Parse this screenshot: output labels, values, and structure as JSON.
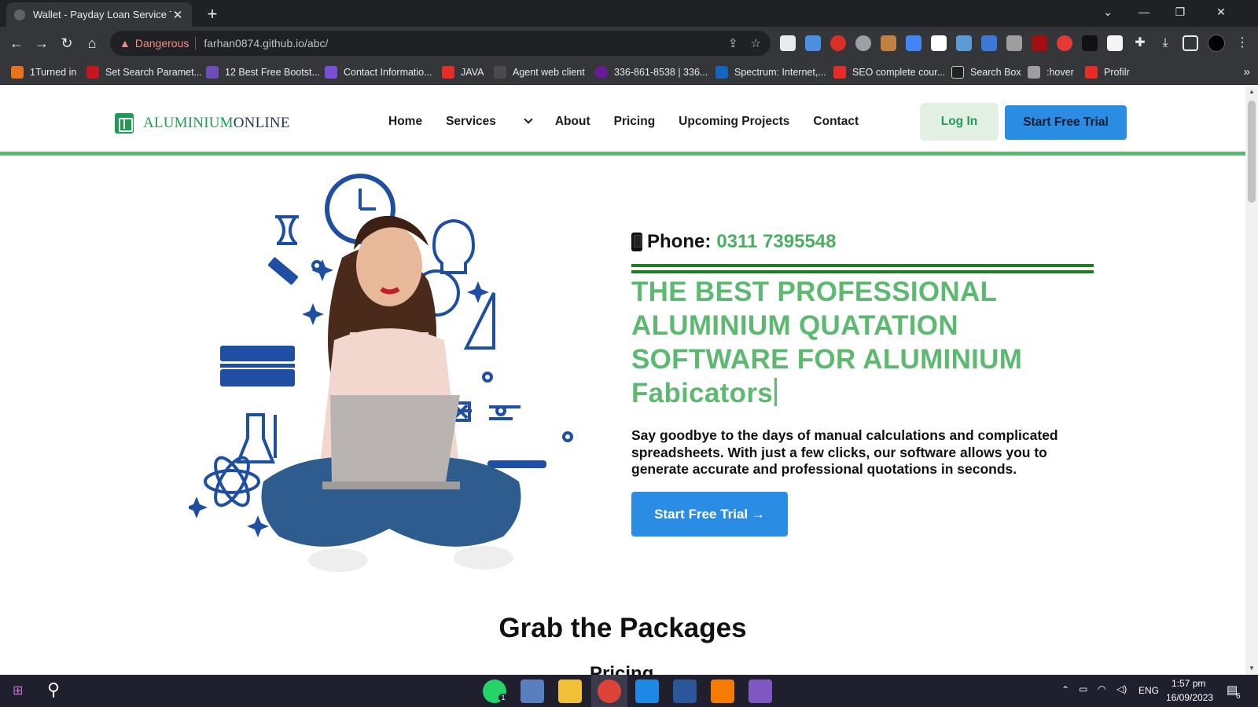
{
  "browser": {
    "tab_title": "Wallet - Payday Loan Service Tem",
    "security_label": "Dangerous",
    "url": "farhan0874.github.io/abc/",
    "bookmarks": [
      {
        "label": "1Turned in",
        "color": "#e8731c"
      },
      {
        "label": "Set Search Paramet...",
        "color": "#c4161c"
      },
      {
        "label": "12 Best Free Bootst...",
        "color": "#6a4fb8"
      },
      {
        "label": "Contact Informatio...",
        "color": "#7a4fd6"
      },
      {
        "label": "JAVA",
        "color": "#e52d27"
      },
      {
        "label": "Agent web client",
        "color": "#4a4a4a"
      },
      {
        "label": "336-861-8538 | 336...",
        "color": "#6a1b9a"
      },
      {
        "label": "Spectrum: Internet,...",
        "color": "#1565c0"
      },
      {
        "label": "SEO complete cour...",
        "color": "#e52d27"
      },
      {
        "label": "Search Box",
        "color": "#222222"
      },
      {
        "label": ":hover",
        "color": "#9e9e9e"
      },
      {
        "label": "Profilr",
        "color": "#e52d27"
      }
    ]
  },
  "site": {
    "logo_part1": "ALUMINIUM",
    "logo_part2": "ONLINE",
    "nav": {
      "home": "Home",
      "services": "Services",
      "about": "About",
      "pricing": "Pricing",
      "projects": "Upcoming Projects",
      "contact": "Contact"
    },
    "login": "Log In",
    "trial": "Start Free Trial"
  },
  "hero": {
    "phone_label": "Phone:",
    "phone_number": "0311 7395548",
    "headline": "THE BEST PROFESSIONAL ALUMINIUM QUATATION SOFTWARE FOR ALUMINIUM Fabicators",
    "lead": "Say goodbye to the days of manual calculations and complicated spreadsheets. With just a few clicks, our software allows you to generate accurate and professional quotations in seconds.",
    "cta": "Start Free Trial →"
  },
  "packages": {
    "title": "Grab the Packages",
    "peek": "Pricing"
  },
  "taskbar": {
    "lang": "ENG",
    "time": "1:57 pm",
    "date": "16/09/2023",
    "notif_count": "6",
    "whatsapp_badge": "1"
  }
}
